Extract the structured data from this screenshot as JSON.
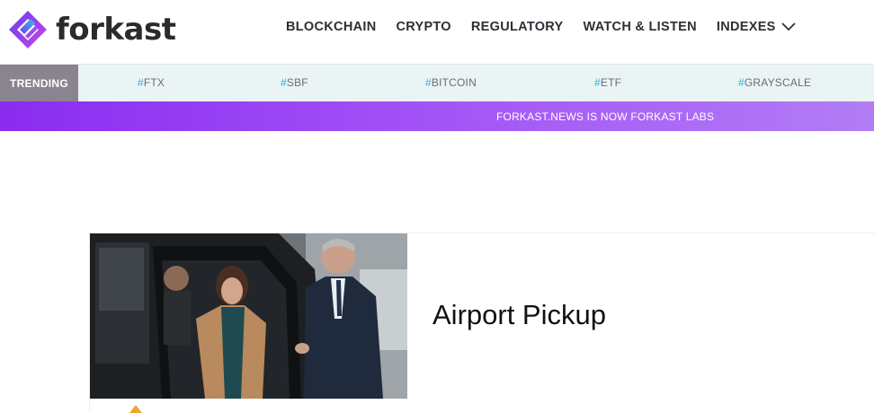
{
  "brand": {
    "name": "forkast",
    "colors": {
      "purple": "#7f3cf5",
      "cyan": "#1fb6d5",
      "text": "#2b2b2b"
    }
  },
  "nav": {
    "items": [
      {
        "label": "BLOCKCHAIN"
      },
      {
        "label": "CRYPTO"
      },
      {
        "label": "REGULATORY"
      },
      {
        "label": "WATCH & LISTEN"
      },
      {
        "label": "INDEXES",
        "icon": "chevron-down-icon"
      }
    ]
  },
  "trending": {
    "label": "TRENDING",
    "tags": [
      {
        "hash": "#",
        "text": "FTX"
      },
      {
        "hash": "#",
        "text": "SBF"
      },
      {
        "hash": "#",
        "text": "BITCOIN"
      },
      {
        "hash": "#",
        "text": "ETF"
      },
      {
        "hash": "#",
        "text": "GRAYSCALE"
      }
    ]
  },
  "banner": {
    "text": "FORKAST.NEWS IS NOW FORKAST LABS"
  },
  "card": {
    "title": "Airport Pickup",
    "image": "photo of a woman exiting a black car with a man in a suit holding the door"
  }
}
